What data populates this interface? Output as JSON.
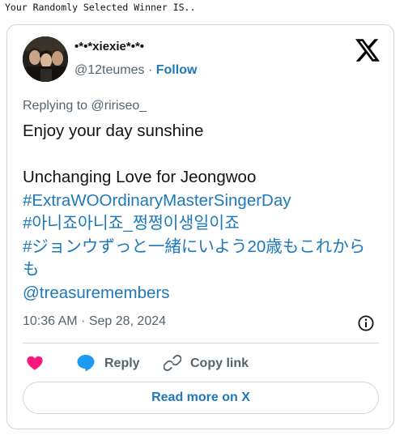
{
  "header": {
    "text": "Your Randomly Selected Winner IS.."
  },
  "tweet": {
    "author": {
      "display_name": "•*•*xiexie*•*•",
      "handle": "@12teumes",
      "separator": "·",
      "follow_label": "Follow",
      "avatar_icon": "avatar-photo"
    },
    "platform_icon": "x-logo-icon",
    "replying_to": "Replying to @ririseo_",
    "text": {
      "line1": "Enjoy your day sunshine",
      "line2": "Unchanging Love for Jeongwoo",
      "hashtag1": "#ExtraWOOrdinaryMasterSingerDay",
      "hashtag2": "#아니죠아니죠_쩡쩡이생일이죠",
      "hashtag3": "#ジョンウずっと一緒にいよう20歳もこれからも",
      "mention": "@treasuremembers"
    },
    "timestamp": "10:36 AM · Sep 28, 2024",
    "actions": {
      "like_icon": "heart-icon",
      "reply_label": "Reply",
      "copy_label": "Copy link"
    },
    "read_more_label": "Read more on X"
  },
  "colors": {
    "link": "#1d79b9",
    "heart": "#f91880",
    "reply_icon": "#1d9bf0",
    "muted": "#536471",
    "border": "#cfd9de"
  }
}
